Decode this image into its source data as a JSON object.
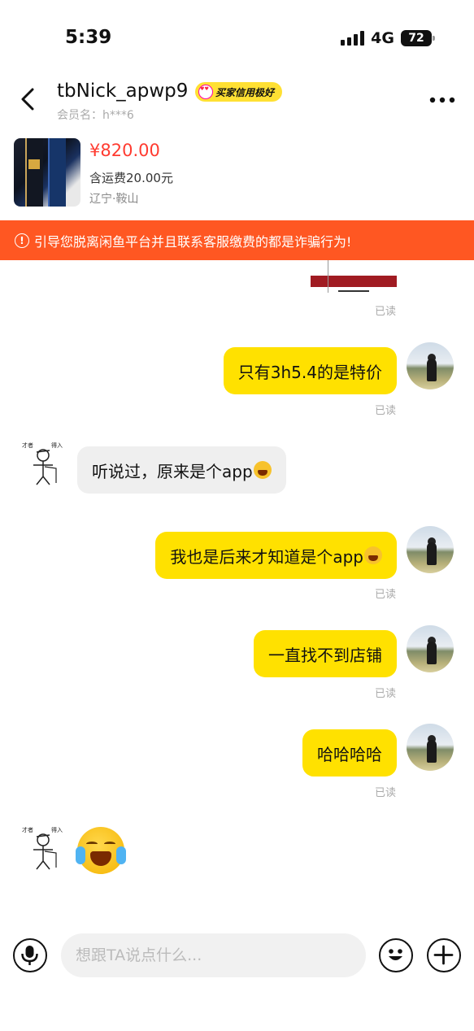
{
  "status_bar": {
    "time": "5:39",
    "network": "4G",
    "battery": "72"
  },
  "header": {
    "nickname": "tbNick_apwp9",
    "credit_badge": "买家信用极好",
    "member_name": "会员名：h***6",
    "more_icon": "more-dots-icon"
  },
  "product": {
    "price": "¥820.00",
    "shipping": "含运费20.00元",
    "location": "辽宁·鞍山"
  },
  "warning": {
    "icon": "info-circle-icon",
    "text": "引导您脱离闲鱼平台并且联系客服缴费的都是诈骗行为!"
  },
  "messages": [
    {
      "from": "me",
      "type": "image",
      "status": "已读"
    },
    {
      "from": "me",
      "type": "text",
      "text": "只有3h5.4的是特价",
      "status": "已读"
    },
    {
      "from": "them",
      "type": "text",
      "text": "听说过，原来是个app",
      "emoji": "crying-laughing"
    },
    {
      "from": "me",
      "type": "text",
      "text": "我也是后来才知道是个app",
      "emoji": "crying-laughing",
      "status": "已读"
    },
    {
      "from": "me",
      "type": "text",
      "text": "一直找不到店铺",
      "status": "已读"
    },
    {
      "from": "me",
      "type": "text",
      "text": "哈哈哈哈",
      "status": "已读"
    },
    {
      "from": "them",
      "type": "emoji",
      "emoji": "crying-laughing"
    }
  ],
  "input": {
    "placeholder": "想跟TA说点什么..."
  },
  "colors": {
    "accent": "#ffe100",
    "price": "#ff3b30",
    "warning_bg": "#ff5722",
    "their_bubble": "#efefef"
  }
}
